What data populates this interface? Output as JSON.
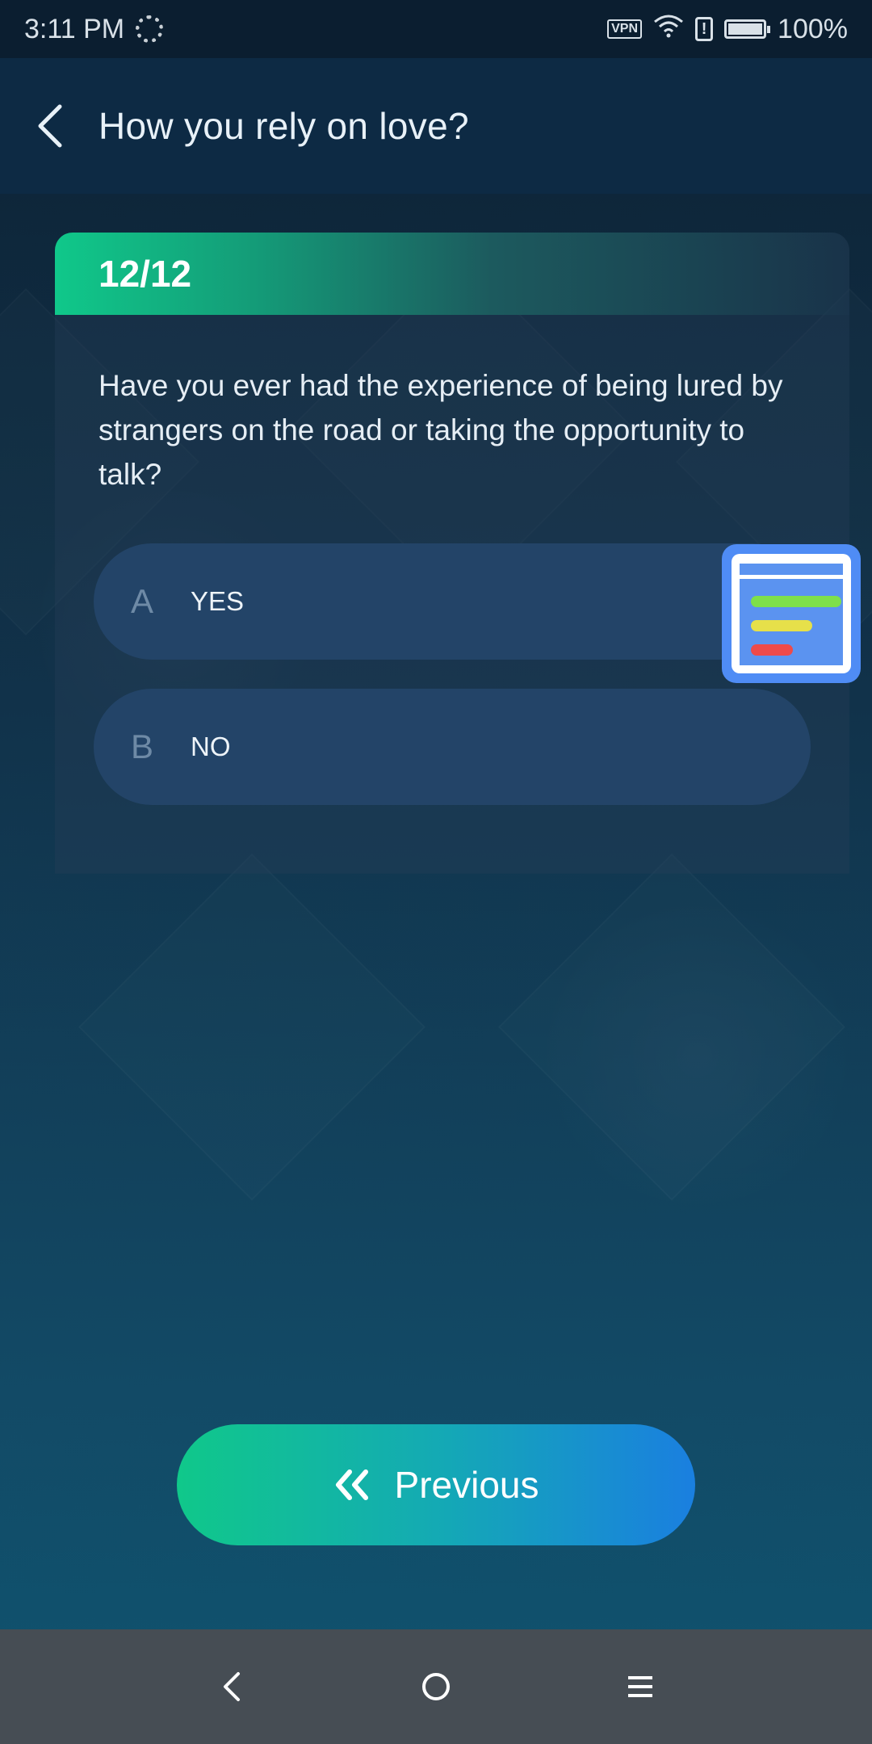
{
  "status_bar": {
    "time": "3:11 PM",
    "vpn": "VPN",
    "alert": "!",
    "battery": "100%"
  },
  "header": {
    "title": "How you rely on love?"
  },
  "quiz": {
    "progress": "12/12",
    "question": "Have you ever had the experience of being lured by strangers on the road or taking the opportunity to talk?",
    "options": [
      {
        "letter": "A",
        "text": "YES"
      },
      {
        "letter": "B",
        "text": "NO"
      }
    ]
  },
  "float_widget": {
    "icon": "list-overlay-icon",
    "bar_colors": [
      "#7ee04a",
      "#e6e04a",
      "#ee4a4a"
    ]
  },
  "actions": {
    "previous_label": "Previous",
    "previous_icon": "double-chevron-left-icon"
  },
  "colors": {
    "accent_green": "#10c88a",
    "accent_blue": "#1a7fe0",
    "option_bg": "#234468",
    "header_bg": "#0d2a44"
  },
  "nav_bar": {
    "icons": [
      "nav-back-icon",
      "nav-home-icon",
      "nav-menu-icon"
    ]
  }
}
